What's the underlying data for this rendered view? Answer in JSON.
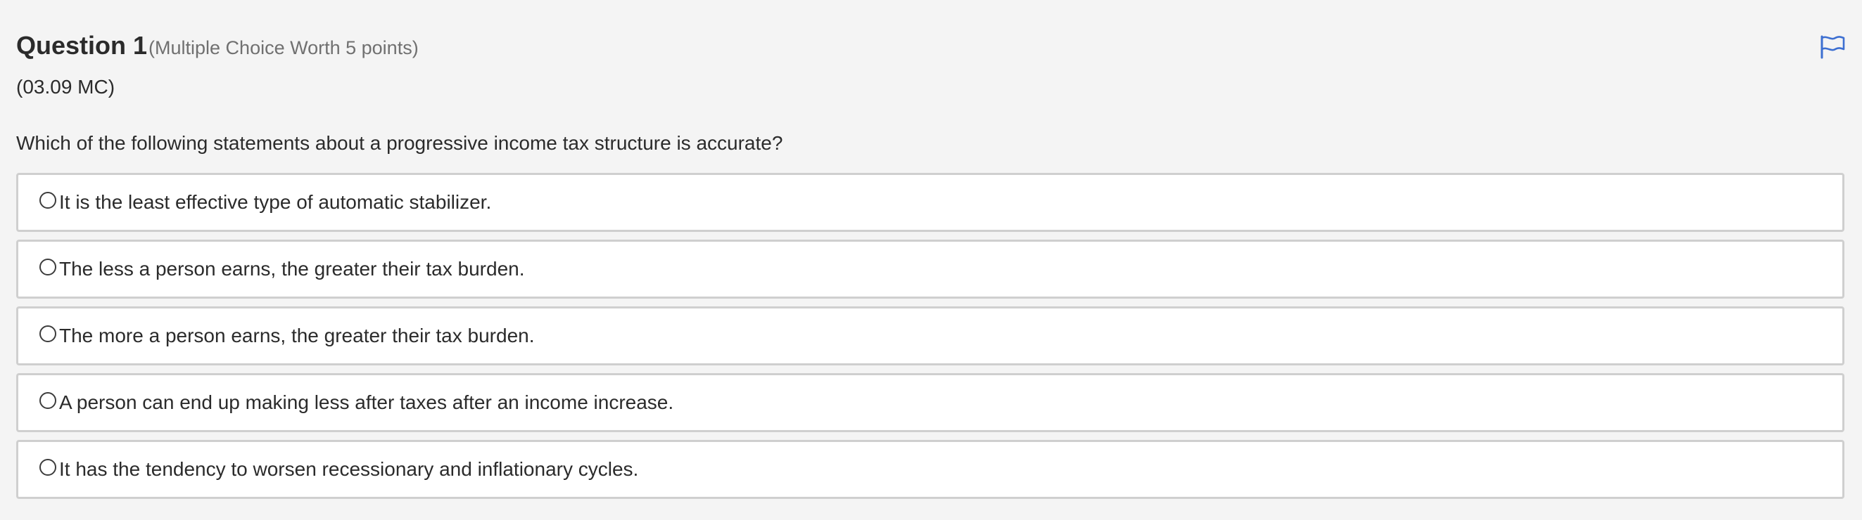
{
  "question": {
    "title": "Question 1",
    "meta": "(Multiple Choice Worth 5 points)",
    "code": "(03.09 MC)",
    "prompt": "Which of the following statements about a progressive income tax structure is accurate?",
    "flag_icon": "flag-icon",
    "accent_color": "#3d6fd1"
  },
  "options": [
    {
      "label": "It is the least effective type of automatic stabilizer.",
      "selected": false
    },
    {
      "label": "The less a person earns, the greater their tax burden.",
      "selected": false
    },
    {
      "label": "The more a person earns, the greater their tax burden.",
      "selected": false
    },
    {
      "label": "A person can end up making less after taxes after an income increase.",
      "selected": false
    },
    {
      "label": "It has the tendency to worsen recessionary and inflationary cycles.",
      "selected": false
    }
  ]
}
